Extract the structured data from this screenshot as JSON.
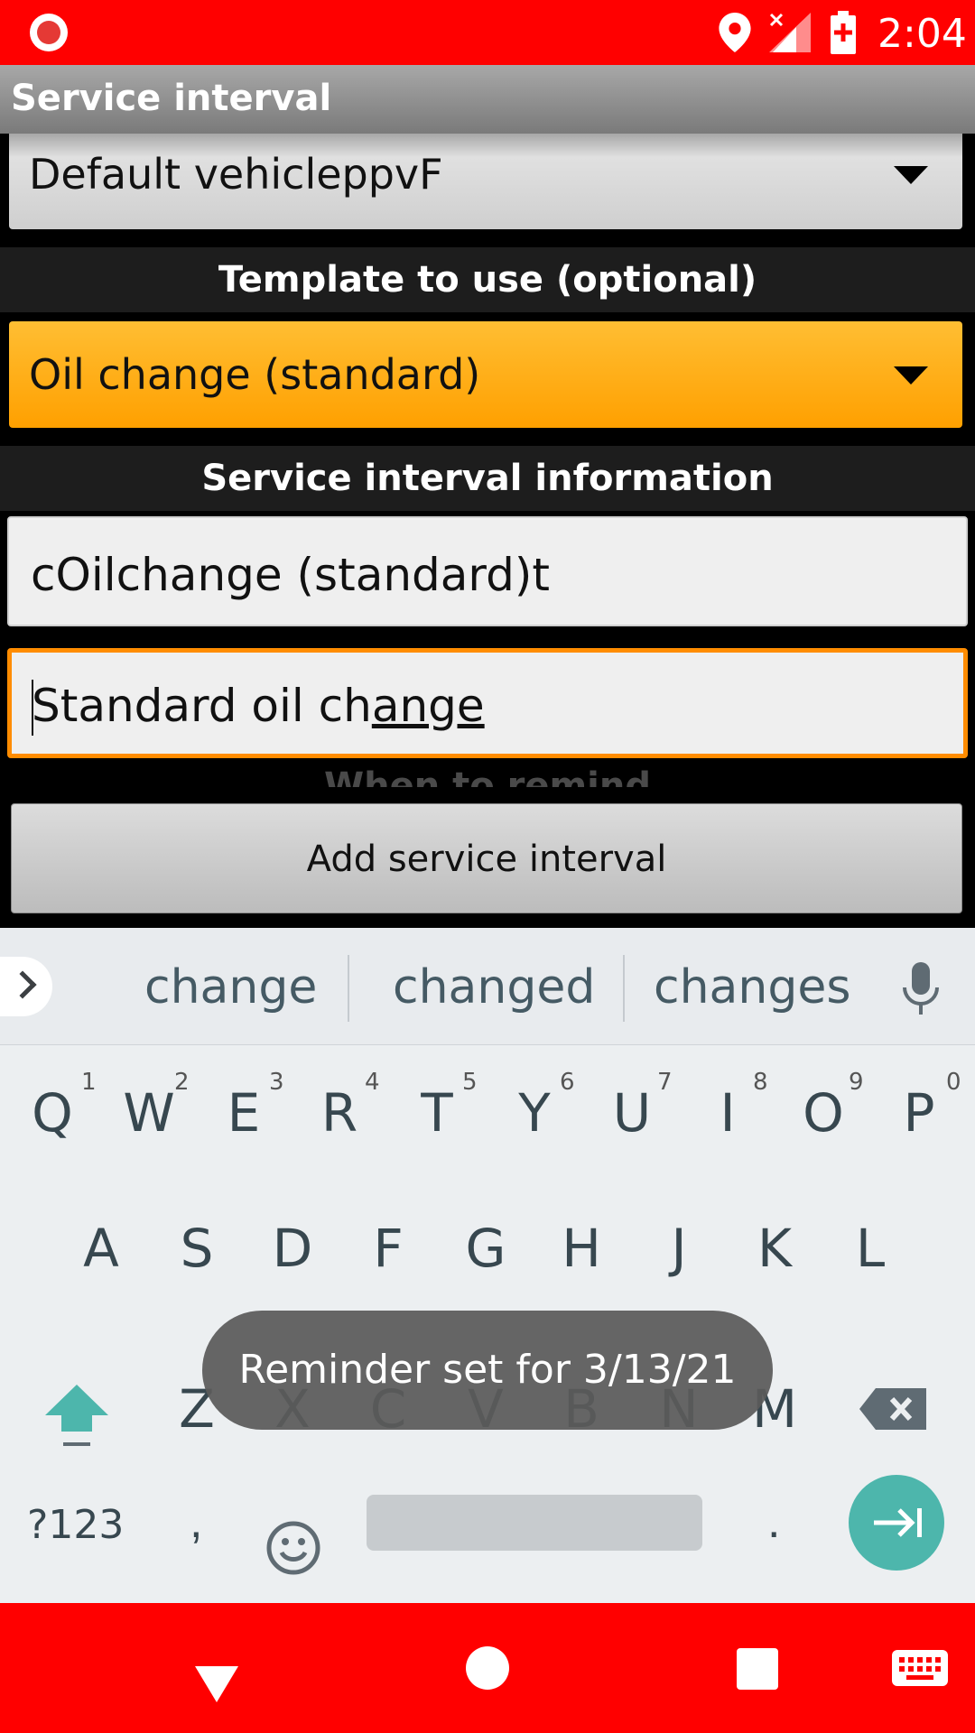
{
  "status_bar": {
    "time": "2:04",
    "icons": [
      "screen-record-icon",
      "location-pin-icon",
      "signal-no-data-icon",
      "battery-charging-icon"
    ]
  },
  "title_bar": {
    "title": "Service interval"
  },
  "form": {
    "vehicle_spinner": {
      "value": "Default vehicleppvF"
    },
    "template_header": "Template to use (optional)",
    "template_spinner": {
      "value": "Oil change (standard)"
    },
    "info_header": "Service interval information",
    "name_field": {
      "value": "cOilchange (standard)t"
    },
    "description_field": {
      "value_plain": "Standard oil ch",
      "value_composing": "ange",
      "focused": true
    },
    "next_header_partial": "When to remind",
    "add_button": "Add service interval"
  },
  "keyboard": {
    "suggestions": [
      "change",
      "changed",
      "changes"
    ],
    "row1": [
      {
        "letter": "Q",
        "hint": "1"
      },
      {
        "letter": "W",
        "hint": "2"
      },
      {
        "letter": "E",
        "hint": "3"
      },
      {
        "letter": "R",
        "hint": "4"
      },
      {
        "letter": "T",
        "hint": "5"
      },
      {
        "letter": "Y",
        "hint": "6"
      },
      {
        "letter": "U",
        "hint": "7"
      },
      {
        "letter": "I",
        "hint": "8"
      },
      {
        "letter": "O",
        "hint": "9"
      },
      {
        "letter": "P",
        "hint": "0"
      }
    ],
    "row2": [
      "A",
      "S",
      "D",
      "F",
      "G",
      "H",
      "J",
      "K",
      "L"
    ],
    "row3": [
      "Z",
      "X",
      "C",
      "V",
      "B",
      "N",
      "M"
    ],
    "symbols_label": "?123",
    "comma": ",",
    "period": ".",
    "accent_color": "#4db6ac"
  },
  "toast": {
    "message": "Reminder set for 3/13/21"
  },
  "colors": {
    "system_bars": "#ff0000",
    "template_spinner": "#ffa000",
    "focus_border": "#ff8c00"
  }
}
